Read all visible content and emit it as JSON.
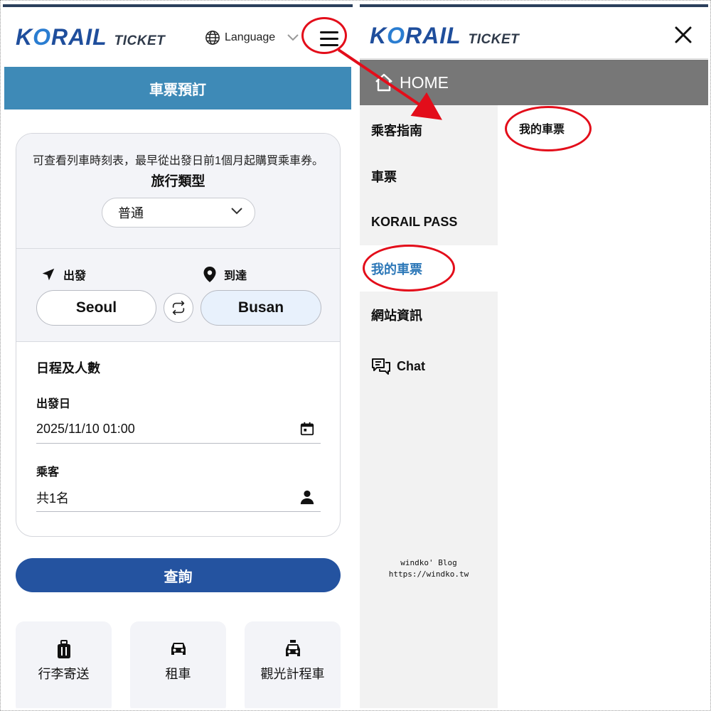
{
  "brand": {
    "name_pre": "K",
    "name_o": "O",
    "name_post": "RAIL",
    "ticket": "TICKET"
  },
  "left": {
    "language_label": "Language",
    "booking_title": "車票預訂",
    "notice": "可查看列車時刻表，最早從出發日前1個月起購買乘車券。",
    "trip_type_title": "旅行類型",
    "trip_type_value": "普通",
    "departure_label": "出發",
    "arrival_label": "到達",
    "departure_station": "Seoul",
    "arrival_station": "Busan",
    "schedule_title": "日程及人數",
    "date_label": "出發日",
    "date_value": "2025/11/10 01:00",
    "passenger_label": "乘客",
    "passenger_value": "共1名",
    "search_label": "查詢",
    "services": [
      {
        "label": "行李寄送",
        "icon": "luggage-icon"
      },
      {
        "label": "租車",
        "icon": "car-icon"
      },
      {
        "label": "觀光計程車",
        "icon": "taxi-icon"
      }
    ]
  },
  "right": {
    "home_label": "HOME",
    "menu": [
      {
        "label": "乘客指南",
        "active": false
      },
      {
        "label": "車票",
        "active": false
      },
      {
        "label": "KORAIL PASS",
        "active": false
      },
      {
        "label": "我的車票",
        "active": true
      },
      {
        "label": "網站資訊",
        "active": false
      },
      {
        "label": "Chat",
        "active": false
      }
    ],
    "submenu_item": "我的車票",
    "watermark_line1": "windko' Blog",
    "watermark_line2": "https://windko.tw"
  },
  "colors": {
    "accent_blue": "#2453a0",
    "booking_bar": "#3e8ab7",
    "active_menu_text": "#2d78b8",
    "home_bar": "#777777",
    "annotation_red": "#e30d1a"
  }
}
